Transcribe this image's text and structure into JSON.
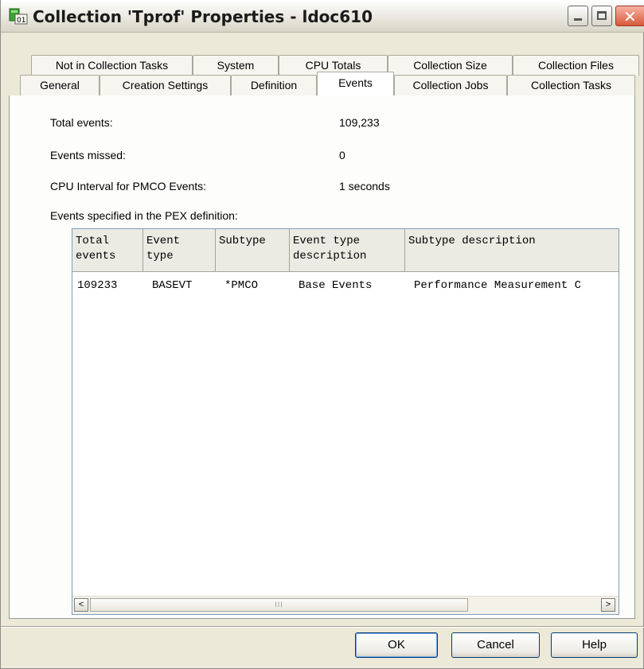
{
  "window": {
    "title": "Collection 'Tprof' Properties - ldoc610",
    "icon": "collection-app-icon",
    "controls": [
      "minimize-icon",
      "maximize-icon",
      "close-icon"
    ]
  },
  "tabs": {
    "row1": [
      "Not in Collection Tasks",
      "System",
      "CPU Totals",
      "Collection Size",
      "Collection Files"
    ],
    "row2": [
      "General",
      "Creation Settings",
      "Definition",
      "Events",
      "Collection Jobs",
      "Collection Tasks"
    ],
    "selected": "Events"
  },
  "events": {
    "total_events_label": "Total events:",
    "total_events_value": "109,233",
    "events_missed_label": "Events missed:",
    "events_missed_value": "0",
    "cpu_interval_label": "CPU Interval for PMCO Events:",
    "cpu_interval_value": "1 seconds",
    "specified_label": "Events specified in the PEX definition:"
  },
  "table": {
    "columns": [
      "Total\nevents",
      "Event\ntype",
      "Subtype",
      "Event type\ndescription",
      "Subtype description"
    ],
    "rows": [
      [
        "109233",
        "BASEVT",
        "*PMCO",
        "Base Events",
        "Performance Measurement C"
      ]
    ],
    "scroll_thumb": "III",
    "scroll_left": "<",
    "scroll_right": ">"
  },
  "buttons": {
    "ok": "OK",
    "cancel": "Cancel",
    "help": "Help"
  }
}
